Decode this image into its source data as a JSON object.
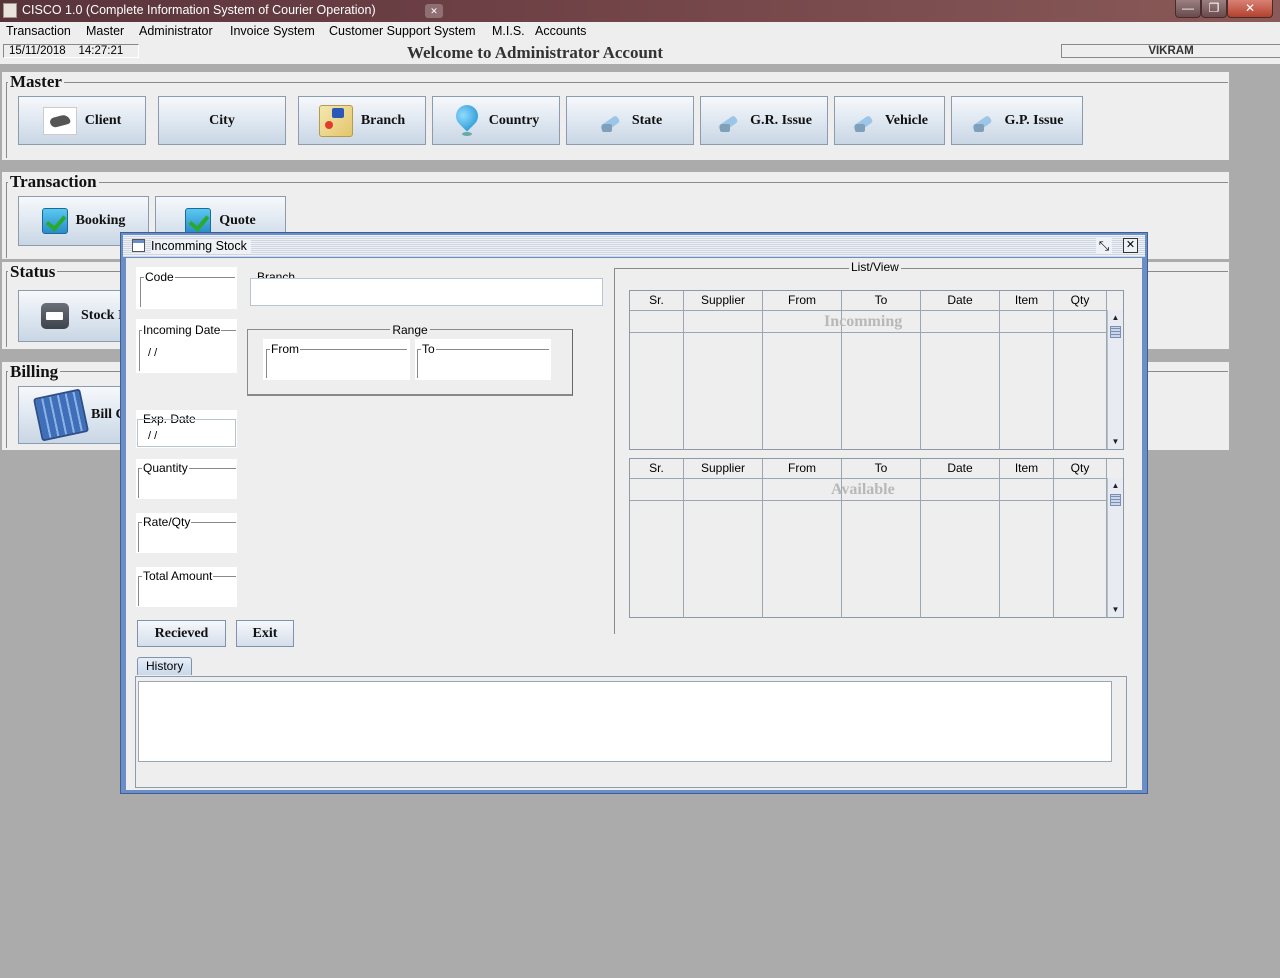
{
  "window": {
    "title": "CISCO 1.0 (Complete Information System of Courier Operation)",
    "min": "—",
    "max": "❐",
    "close": "✕"
  },
  "menubar": [
    "Transaction",
    "Master",
    "Administrator",
    "Invoice System",
    "Customer Support System",
    "M.I.S.",
    "Accounts"
  ],
  "status": {
    "date": "15/11/2018",
    "time": "14:27:21",
    "welcome": "Welcome to Administrator Account",
    "user": "VIKRAM"
  },
  "desktop": {
    "master": {
      "label": "Master",
      "buttons": {
        "client": "Client",
        "city": "City",
        "branch": "Branch",
        "country": "Country",
        "state": "State",
        "gr_issue": "G.R. Issue",
        "vehicle": "Vehicle",
        "gp_issue": "G.P. Issue"
      }
    },
    "transaction": {
      "label": "Transaction",
      "buttons": {
        "booking": "Booking",
        "quote": "Quote"
      }
    },
    "status": {
      "label": "Status",
      "buttons": {
        "stock": "Stock I"
      }
    },
    "billing": {
      "label": "Billing",
      "buttons": {
        "bill": "Bill C"
      }
    }
  },
  "dialog": {
    "title": "Incomming Stock",
    "fields": {
      "code": {
        "label": "Code",
        "value": ""
      },
      "branch": {
        "label": "Branch",
        "value": ""
      },
      "incoming_date": {
        "label": "Incoming Date",
        "value": " / /"
      },
      "range": {
        "label": "Range",
        "from_label": "From",
        "to_label": "To"
      },
      "exp_date": {
        "label": "Exp. Date",
        "value": " / /"
      },
      "quantity": {
        "label": "Quantity",
        "value": ""
      },
      "rate_qty": {
        "label": "Rate/Qty",
        "value": ""
      },
      "total_amount": {
        "label": "Total Amount",
        "value": ""
      }
    },
    "buttons": {
      "received": "Recieved",
      "exit": "Exit"
    },
    "listview": {
      "label": "List/View",
      "columns": [
        "Sr.",
        "Supplier",
        "From",
        "To",
        "Date",
        "Item",
        "Qty"
      ],
      "incoming_watermark": "Incomming",
      "available_watermark": "Available"
    },
    "history_tab": "History"
  }
}
